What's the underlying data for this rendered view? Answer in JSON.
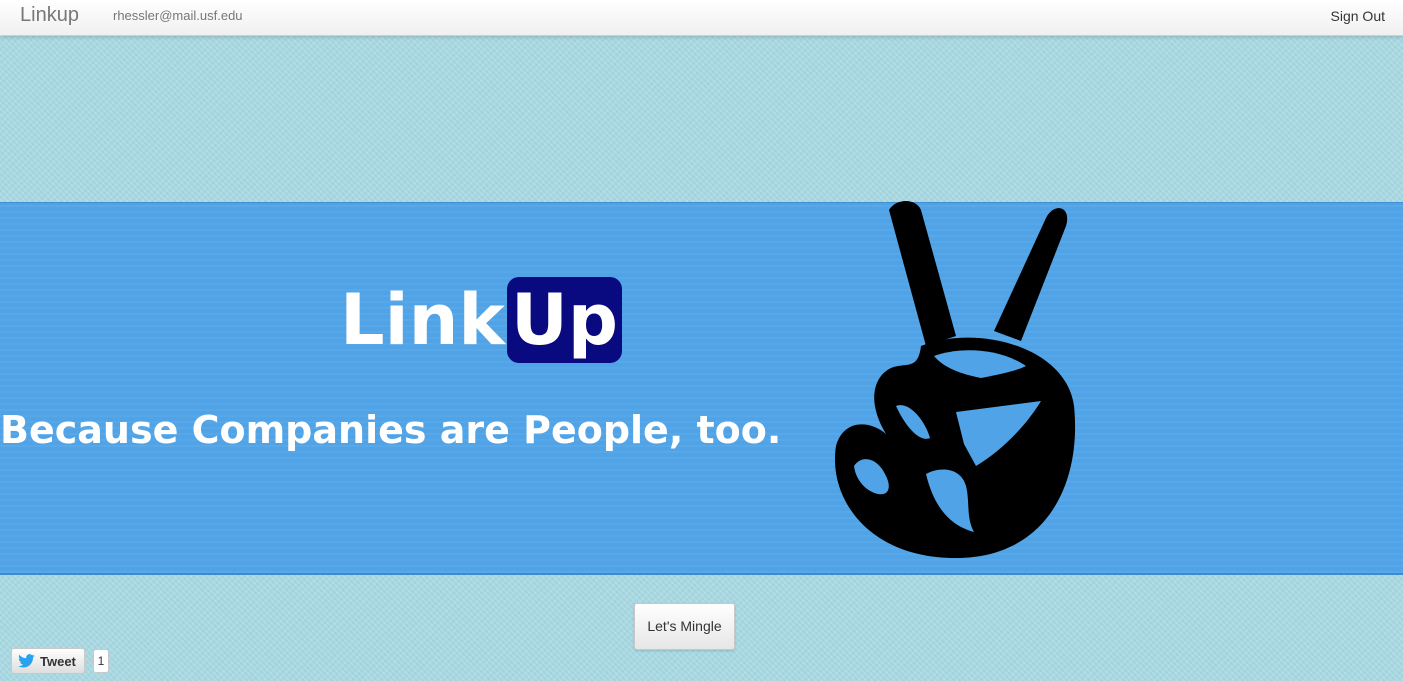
{
  "navbar": {
    "brand": "Linkup",
    "user_email": "rhessler@mail.usf.edu",
    "sign_out": "Sign Out"
  },
  "hero": {
    "logo_text_link": "Link",
    "logo_text_up": "Up",
    "tagline": "Because Companies are People, too.",
    "icon": "peace-sign-hand-icon"
  },
  "actions": {
    "mingle_label": "Let's Mingle"
  },
  "twitter": {
    "tweet_label": "Tweet",
    "tweet_count": "1",
    "icon": "twitter-bird-icon"
  },
  "colors": {
    "page_background": "#a8d9e3",
    "hero_background": "#4fa3e6",
    "logo_up_badge": "#0a0a80",
    "icon_fill": "#000000"
  }
}
